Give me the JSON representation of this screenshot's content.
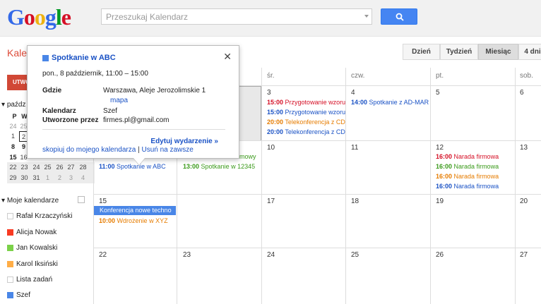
{
  "search": {
    "placeholder": "Przeszukaj Kalendarz"
  },
  "app": {
    "title": "Kalendarz",
    "create_label": "UTWÓRZ"
  },
  "views": [
    "Dzień",
    "Tydzień",
    "Miesiąc",
    "4 dni"
  ],
  "active_view": "Miesiąc",
  "weekdays": [
    "śr.",
    "czw.",
    "pt.",
    "sob."
  ],
  "minical": {
    "month_label": "paźdz",
    "weekday_letters": [
      "P",
      "W"
    ],
    "rows": [
      [
        "24",
        "25"
      ],
      [
        "1",
        "2"
      ],
      [
        "8",
        "9"
      ],
      [
        "15",
        "16"
      ],
      [
        "22",
        "23",
        "24",
        "25",
        "26",
        "27",
        "28"
      ],
      [
        "29",
        "30",
        "31",
        "1",
        "2",
        "3",
        "4"
      ]
    ]
  },
  "my_calendars": {
    "header": "Moje kalendarze",
    "items": [
      {
        "name": "Rafał Krzaczyński",
        "color": "#ffffff"
      },
      {
        "name": "Alicja Nowak",
        "color": "#f83a22"
      },
      {
        "name": "Jan Kowalski",
        "color": "#7bd148"
      },
      {
        "name": "Karol Iksiński",
        "color": "#ffad46"
      },
      {
        "name": "Lista zadań",
        "color": "#ffffff"
      },
      {
        "name": "Szef",
        "color": "#4986e7"
      }
    ]
  },
  "days": {
    "d3": "3",
    "d4": "4",
    "d5": "5",
    "d6": "6",
    "d10": "10",
    "d11": "11",
    "d12": "12",
    "d13": "13",
    "d15": "15",
    "d17": "17",
    "d18": "18",
    "d19": "19",
    "d20": "20",
    "d22": "22",
    "d23": "23",
    "d24": "24",
    "d25": "25",
    "d26": "26",
    "d27": "27"
  },
  "events": {
    "e3a": {
      "time": "15:00",
      "title": "Przygotowanie wzoru",
      "color": "#d50f25"
    },
    "e3b": {
      "time": "15:00",
      "title": "Przygotowanie wzoru",
      "color": "#1a52c5"
    },
    "e3c": {
      "time": "20:00",
      "title": "Telekonferencja z CD",
      "color": "#e67c00"
    },
    "e3d": {
      "time": "20:00",
      "title": "Telekonferencja z CD",
      "color": "#1a52c5"
    },
    "e4a": {
      "time": "14:00",
      "title": "Spotkanie z AD-MAR",
      "color": "#1a52c5"
    },
    "e9a": {
      "title": "mowy",
      "color": "#3a9a1a"
    },
    "e9b": {
      "time": "13:00",
      "title": "Spotkanie w 12345",
      "color": "#3a9a1a"
    },
    "e8a": {
      "time": "11:00",
      "title": "Spotkanie w ABC",
      "color": "#1a52c5"
    },
    "e12a": {
      "time": "16:00",
      "title": "Narada firmowa",
      "color": "#d50f25"
    },
    "e12b": {
      "time": "16:00",
      "title": "Narada firmowa",
      "color": "#3a9a1a"
    },
    "e12c": {
      "time": "16:00",
      "title": "Narada firmowa",
      "color": "#e67c00"
    },
    "e12d": {
      "time": "16:00",
      "title": "Narada firmowa",
      "color": "#1a52c5"
    },
    "e15a": {
      "title": "Konferencja nowe techno"
    },
    "e15b": {
      "time": "10:00",
      "title": "Wdrożenie w XYZ",
      "color": "#e67c00"
    }
  },
  "popup": {
    "title": "Spotkanie w ABC",
    "when": "pon., 8 październik, 11:00 – 15:00",
    "where_label": "Gdzie",
    "where": "Warszawa, Aleje Jerozolimskie 1",
    "map_link": "mapa",
    "calendar_label": "Kalendarz",
    "calendar": "Szef",
    "created_label": "Utworzone przez",
    "created": "firmes.pl@gmail.com",
    "edit_link": "Edytuj wydarzenie »",
    "copy_link": "skopiuj do mojego kalendarza",
    "delete_link": "Usuń na zawsze"
  }
}
